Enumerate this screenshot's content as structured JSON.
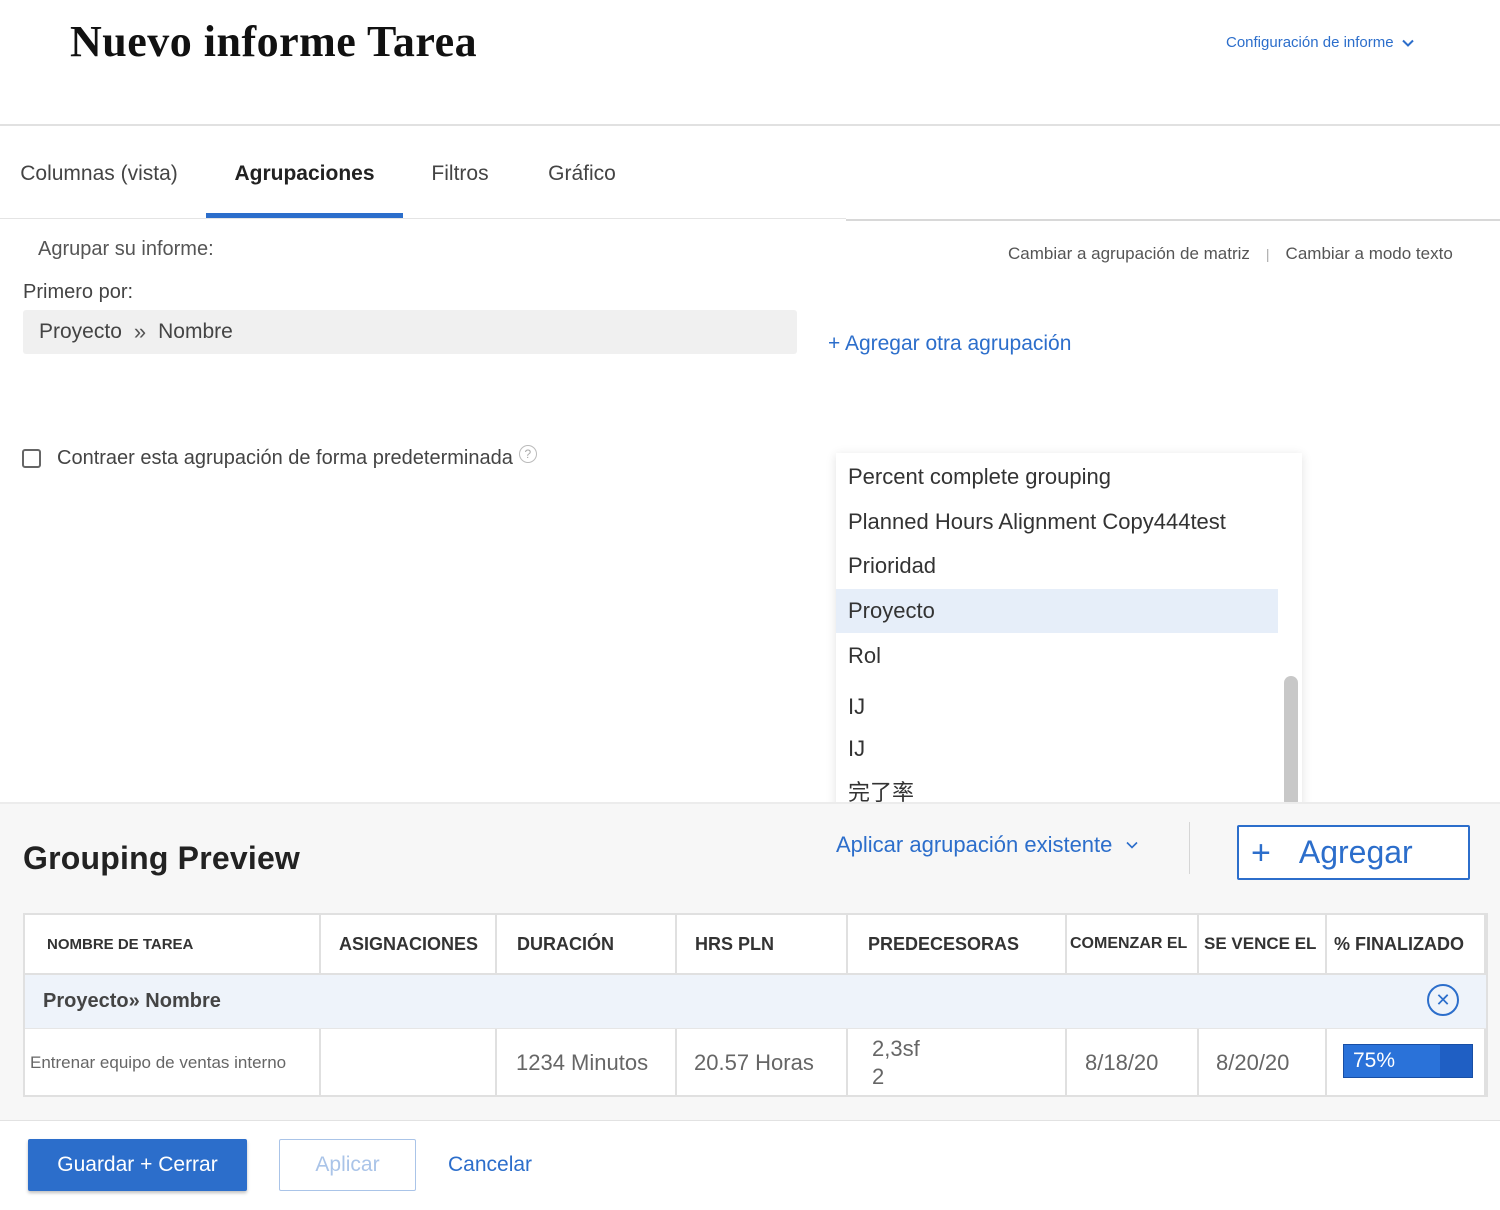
{
  "header": {
    "title": "Nuevo informe Tarea",
    "config_label": "Configuración de informe"
  },
  "tabs": [
    {
      "label": "Columnas (vista)"
    },
    {
      "label": "Agrupaciones"
    },
    {
      "label": "Filtros"
    },
    {
      "label": "Gráfico"
    }
  ],
  "active_tab": "Agrupaciones",
  "grouping": {
    "label": "Agrupar su informe:",
    "switch_matrix": "Cambiar a agrupación de matriz",
    "switch_text": "Cambiar a modo texto",
    "first_by": "Primero por:",
    "field_part1": "Proyecto",
    "field_chevron": "»",
    "field_part2": "Nombre",
    "add_another": "+ Agregar otra agrupación",
    "collapse_label": "Contraer esta agrupación de forma predeterminada",
    "collapse_checked": false,
    "help": "?"
  },
  "dropdown": {
    "items": [
      "Percent complete grouping",
      "Planned Hours Alignment Copy444test",
      "Prioridad",
      "Proyecto",
      "Rol",
      "IJ",
      "IJ",
      "完了率"
    ],
    "selected": "Proyecto"
  },
  "preview": {
    "title": "Grouping Preview",
    "apply_existing": "Aplicar agrupación existente",
    "add_plus": "+",
    "add_label": "Agregar",
    "columns": [
      "NOMBRE DE TAREA",
      "ASIGNACIONES",
      "DURACIÓN",
      "HRS PLN",
      "PREDECESORAS",
      "COMENZAR EL",
      "SE VENCE EL",
      "% FINALIZADO"
    ],
    "group_row": {
      "part1": "Proyecto",
      "chevron": "»",
      "part2": "Nombre",
      "remove_icon": "✕"
    },
    "row": {
      "task_name": "Entrenar equipo de ventas interno",
      "assignments": "",
      "duration": "1234 Minutos",
      "planned_hours": "20.57 Horas",
      "predecessors_line1": "2,3sf",
      "predecessors_line2": "2",
      "start": "8/18/20",
      "due": "8/20/20",
      "percent_complete_label": "75%",
      "percent_complete": 0.75
    }
  },
  "footer": {
    "save_close": "Guardar + Cerrar",
    "apply": "Aplicar",
    "cancel": "Cancelar"
  },
  "colors": {
    "accent": "#2c6ecb",
    "selected_item": "#e6eef9",
    "group_row_bg": "#eef3fa",
    "progress": "#1f5fc4"
  }
}
